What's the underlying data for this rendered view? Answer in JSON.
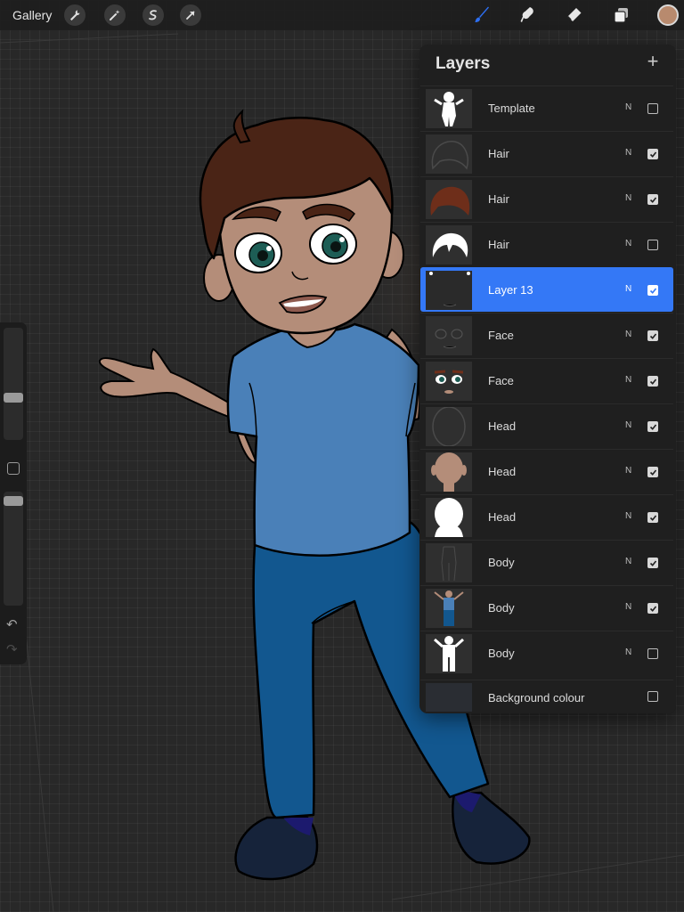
{
  "topbar": {
    "gallery_label": "Gallery",
    "left_tools": [
      "wrench-icon",
      "magic-wand-icon",
      "selection-icon",
      "transform-arrow-icon"
    ],
    "right_tools": [
      "brush-icon",
      "smudge-icon",
      "eraser-icon",
      "layers-icon"
    ],
    "active_tool": "brush",
    "active_tool_color": "#2d6ff2",
    "current_color": "#b88a6e"
  },
  "sidebar": {
    "brush_size_level": 0.25,
    "opacity_level": 0.15,
    "controls": [
      "modify-button",
      "undo-icon",
      "redo-icon"
    ]
  },
  "layers_panel": {
    "title": "Layers",
    "add_icon": "+",
    "selected_color": "#3478f6",
    "layers": [
      {
        "name": "Template",
        "mode": "N",
        "visible": false,
        "selected": false
      },
      {
        "name": "Hair",
        "mode": "N",
        "visible": true,
        "selected": false
      },
      {
        "name": "Hair",
        "mode": "N",
        "visible": true,
        "selected": false
      },
      {
        "name": "Hair",
        "mode": "N",
        "visible": false,
        "selected": false
      },
      {
        "name": "Layer 13",
        "mode": "N",
        "visible": true,
        "selected": true
      },
      {
        "name": "Face",
        "mode": "N",
        "visible": true,
        "selected": false
      },
      {
        "name": "Face",
        "mode": "N",
        "visible": true,
        "selected": false
      },
      {
        "name": "Head",
        "mode": "N",
        "visible": true,
        "selected": false
      },
      {
        "name": "Head",
        "mode": "N",
        "visible": true,
        "selected": false
      },
      {
        "name": "Head",
        "mode": "N",
        "visible": true,
        "selected": false
      },
      {
        "name": "Body",
        "mode": "N",
        "visible": true,
        "selected": false
      },
      {
        "name": "Body",
        "mode": "N",
        "visible": true,
        "selected": false
      },
      {
        "name": "Body",
        "mode": "N",
        "visible": false,
        "selected": false
      }
    ],
    "background": {
      "name": "Background colour",
      "visible": false
    }
  },
  "character_colors": {
    "skin": "#b48d79",
    "hair": "#4a2416",
    "shirt": "#4a80b8",
    "jeans": "#12578f",
    "shoes": "#16233a",
    "eyes": "#1d5d55"
  }
}
